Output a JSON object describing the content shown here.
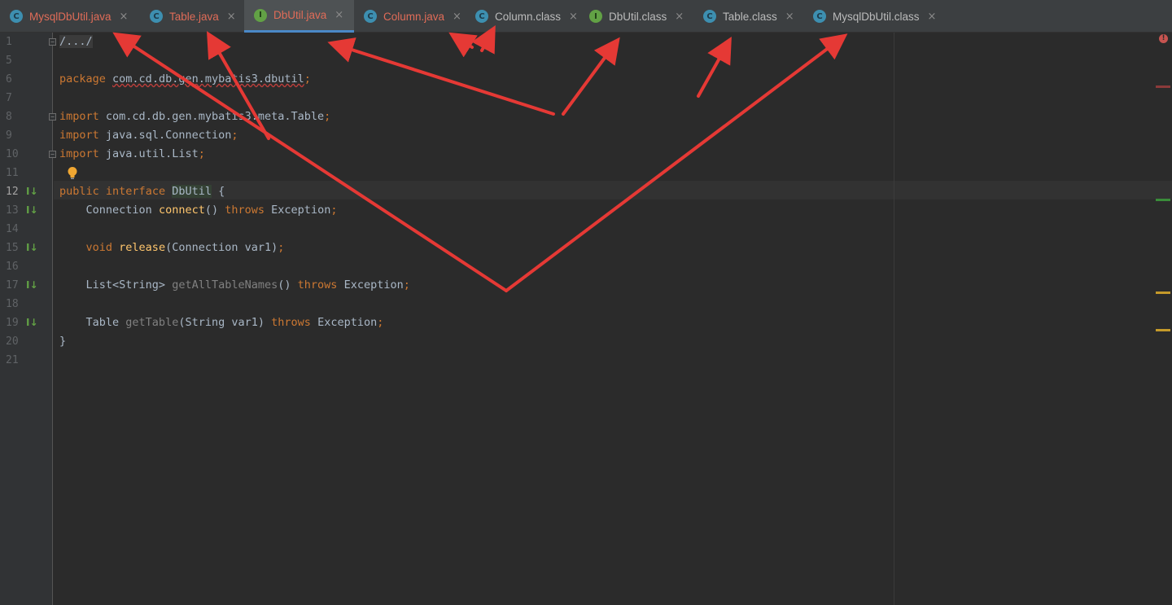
{
  "tabs": [
    {
      "label": "MysqlDbUtil.java",
      "icon": "C",
      "close": "×"
    },
    {
      "label": "Table.java",
      "icon": "C",
      "close": "×"
    },
    {
      "label": "DbUtil.java",
      "icon": "I",
      "close": "×"
    },
    {
      "label": "Column.java",
      "icon": "C",
      "close": "×"
    },
    {
      "label": "Column.class",
      "icon": "C",
      "close": "×"
    },
    {
      "label": "DbUtil.class",
      "icon": "I",
      "close": "×"
    },
    {
      "label": "Table.class",
      "icon": "C",
      "close": "×"
    },
    {
      "label": "MysqlDbUtil.class",
      "icon": "C",
      "close": "×"
    }
  ],
  "line_numbers": [
    "1",
    "5",
    "6",
    "7",
    "8",
    "9",
    "10",
    "11",
    "12",
    "13",
    "14",
    "15",
    "16",
    "17",
    "18",
    "19",
    "20",
    "21"
  ],
  "code": {
    "l1": "/.../",
    "l6_kw": "package",
    "l6_pkg": "com.cd.db.gen.mybatis3.dbutil",
    "l6_semi": ";",
    "l8_kw": "import",
    "l8_txt": "com.cd.db.gen.mybatis3.meta.Table",
    "l9_kw": "import",
    "l9_txt": "java.sql.Connection",
    "l10_kw": "import",
    "l10_txt": "java.util.List",
    "semi": ";",
    "l12_kw1": "public",
    "l12_kw2": "interface",
    "l12_name": "DbUtil",
    "l12_brace": " {",
    "l13_type": "Connection",
    "l13_fn": "connect",
    "l13_paren": "()",
    "l13_throws": "throws",
    "l13_ex": "Exception",
    "l15_void": "void",
    "l15_fn": "release",
    "l15_args": "(Connection var1)",
    "l17_type": "List<String>",
    "l17_fn": "getAllTableNames",
    "l17_paren": "()",
    "l17_throws": "throws",
    "l17_ex": "Exception",
    "l19_type": "Table",
    "l19_fn": "getTable",
    "l19_args": "(String var1)",
    "l19_throws": "throws",
    "l19_ex": "Exception",
    "l20": "}"
  },
  "err_icon": "!",
  "fold_symbol": "−",
  "impl_symbol": "I↓",
  "colors": {
    "background": "#2b2b2b",
    "keyword": "#cc7832",
    "function": "#ffc66d",
    "text": "#a9b7c6",
    "error_tab": "#e06c58",
    "arrow": "#e53935"
  }
}
